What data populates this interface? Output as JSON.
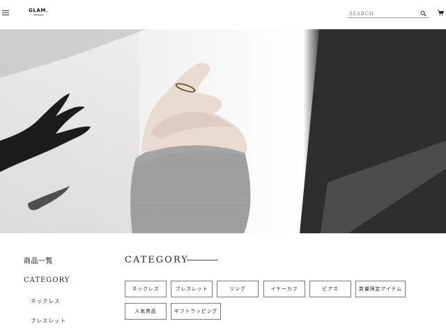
{
  "header": {
    "logo": "GLAM.",
    "search_placeholder": "SEARCH"
  },
  "hero": {
    "image_alt": "hand wearing a thin gold ring against a sunlit wall"
  },
  "sidebar": {
    "all_products": "商品一覧",
    "category_heading": "CATEGORY",
    "subcategories": [
      "ネックレス",
      "ブレスレット"
    ]
  },
  "main": {
    "category_title": "CATEGORY",
    "categories": [
      "ネックレス",
      "ブレスレット",
      "リング",
      "イヤーカフ",
      "ピアス",
      "数量限定アイテム",
      "人気商品",
      "ギフトラッピング"
    ]
  },
  "colors": {
    "text": "#222222",
    "border": "#777777",
    "background": "#ffffff"
  }
}
